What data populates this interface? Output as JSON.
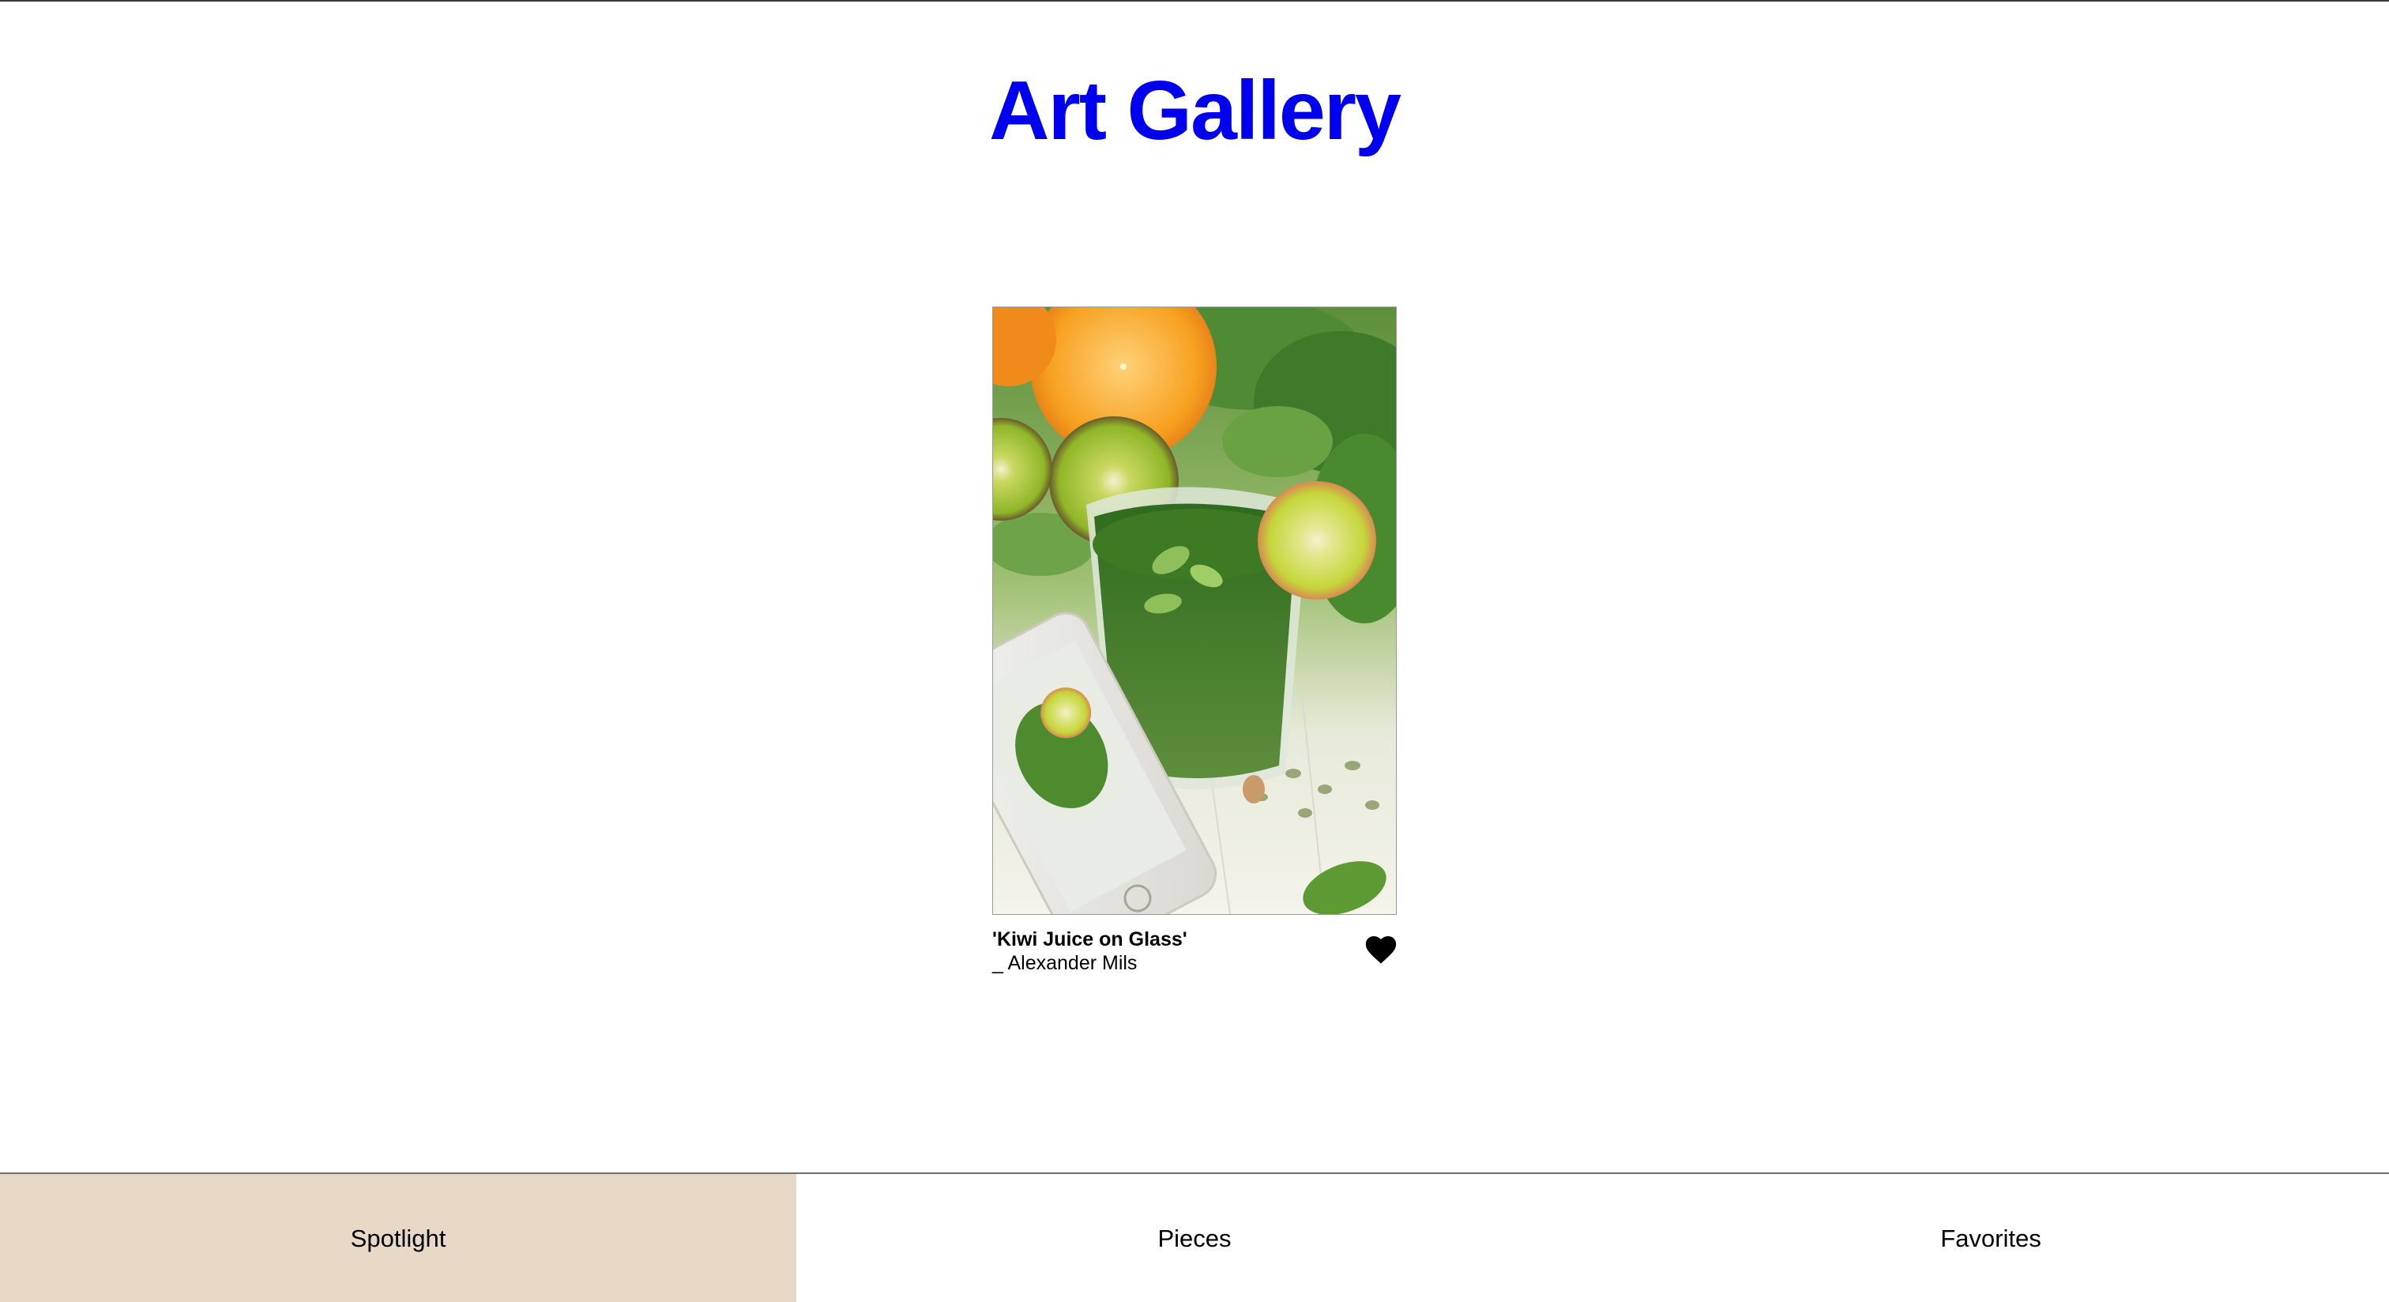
{
  "app": {
    "title": "Art Gallery"
  },
  "spotlight": {
    "artwork": {
      "title": "'Kiwi Juice on Glass'",
      "artist": "_ Alexander Mils",
      "image_icon": "green-smoothie-photo",
      "favorite_icon": "heart-icon",
      "favorited": true
    }
  },
  "nav": {
    "active": "Spotlight",
    "tabs": [
      {
        "label": "Spotlight"
      },
      {
        "label": "Pieces"
      },
      {
        "label": "Favorites"
      }
    ]
  },
  "colors": {
    "title": "#0000ee",
    "active_tab": "#e7d9c5",
    "heart": "#000000"
  }
}
